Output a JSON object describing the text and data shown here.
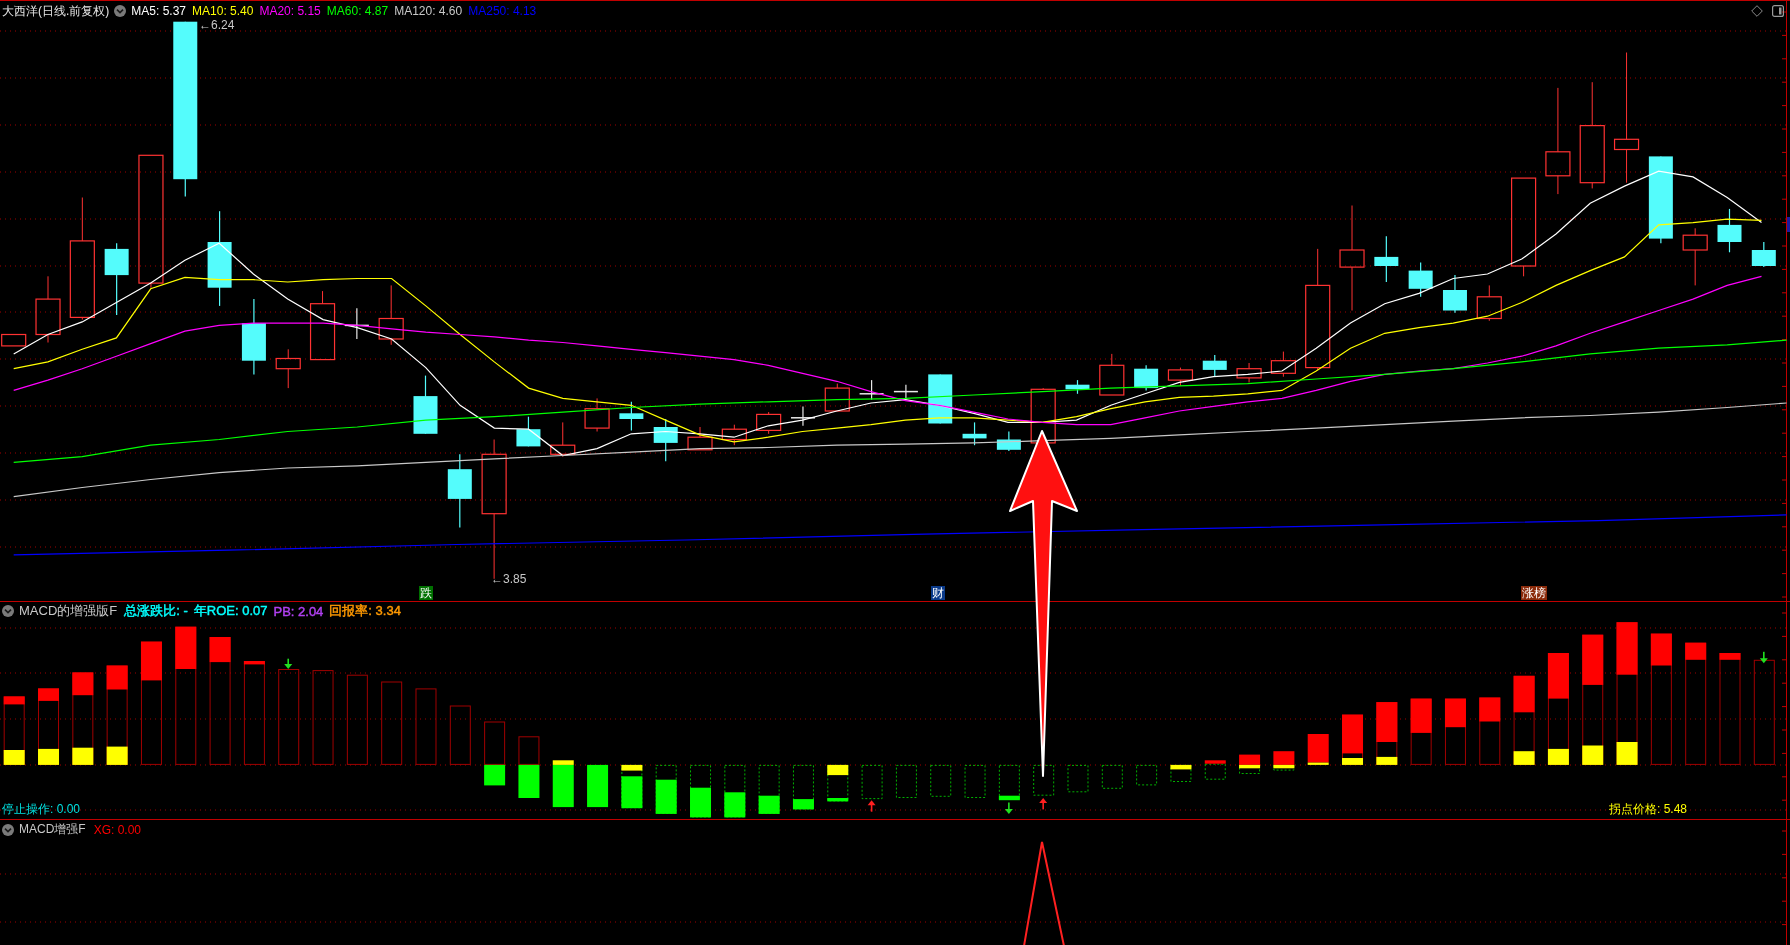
{
  "header": {
    "title": "大西洋(日线.前复权)",
    "moving_averages": [
      {
        "label": "MA5: 5.37",
        "color": "#ffffff"
      },
      {
        "label": "MA10: 5.40",
        "color": "#ffff00"
      },
      {
        "label": "MA20: 5.15",
        "color": "#ff00ff"
      },
      {
        "label": "MA60: 4.87",
        "color": "#00ff00"
      },
      {
        "label": "MA120: 4.60",
        "color": "#c8c8c8"
      },
      {
        "label": "MA250: 4.13",
        "color": "#0000ff"
      }
    ]
  },
  "price_chart": {
    "high_label": "←6.24",
    "low_label": "←3.85",
    "tags": [
      {
        "text": "跌",
        "color": "#007000"
      },
      {
        "text": "财",
        "color": "#0a3a8a"
      },
      {
        "text": "涨榜",
        "color": "#8a2a0a"
      }
    ]
  },
  "macd_panel": {
    "title": "MACD的增强版F",
    "readouts": [
      {
        "label": "总涨跌比: -",
        "color": "#00ffff"
      },
      {
        "label": "年ROE: 0.07",
        "color": "#00ffff"
      },
      {
        "label": "PB: 2.04",
        "color": "#b040f0"
      },
      {
        "label": "回报率: 3.34",
        "color": "#ff9900"
      }
    ],
    "stop_signal": "停止操作: 0.00",
    "turning_price": "拐点价格: 5.48"
  },
  "signal_panel": {
    "title": "MACD增强F",
    "readouts": [
      {
        "label": "XG: 0.00",
        "color": "#ff0000"
      }
    ]
  }
}
